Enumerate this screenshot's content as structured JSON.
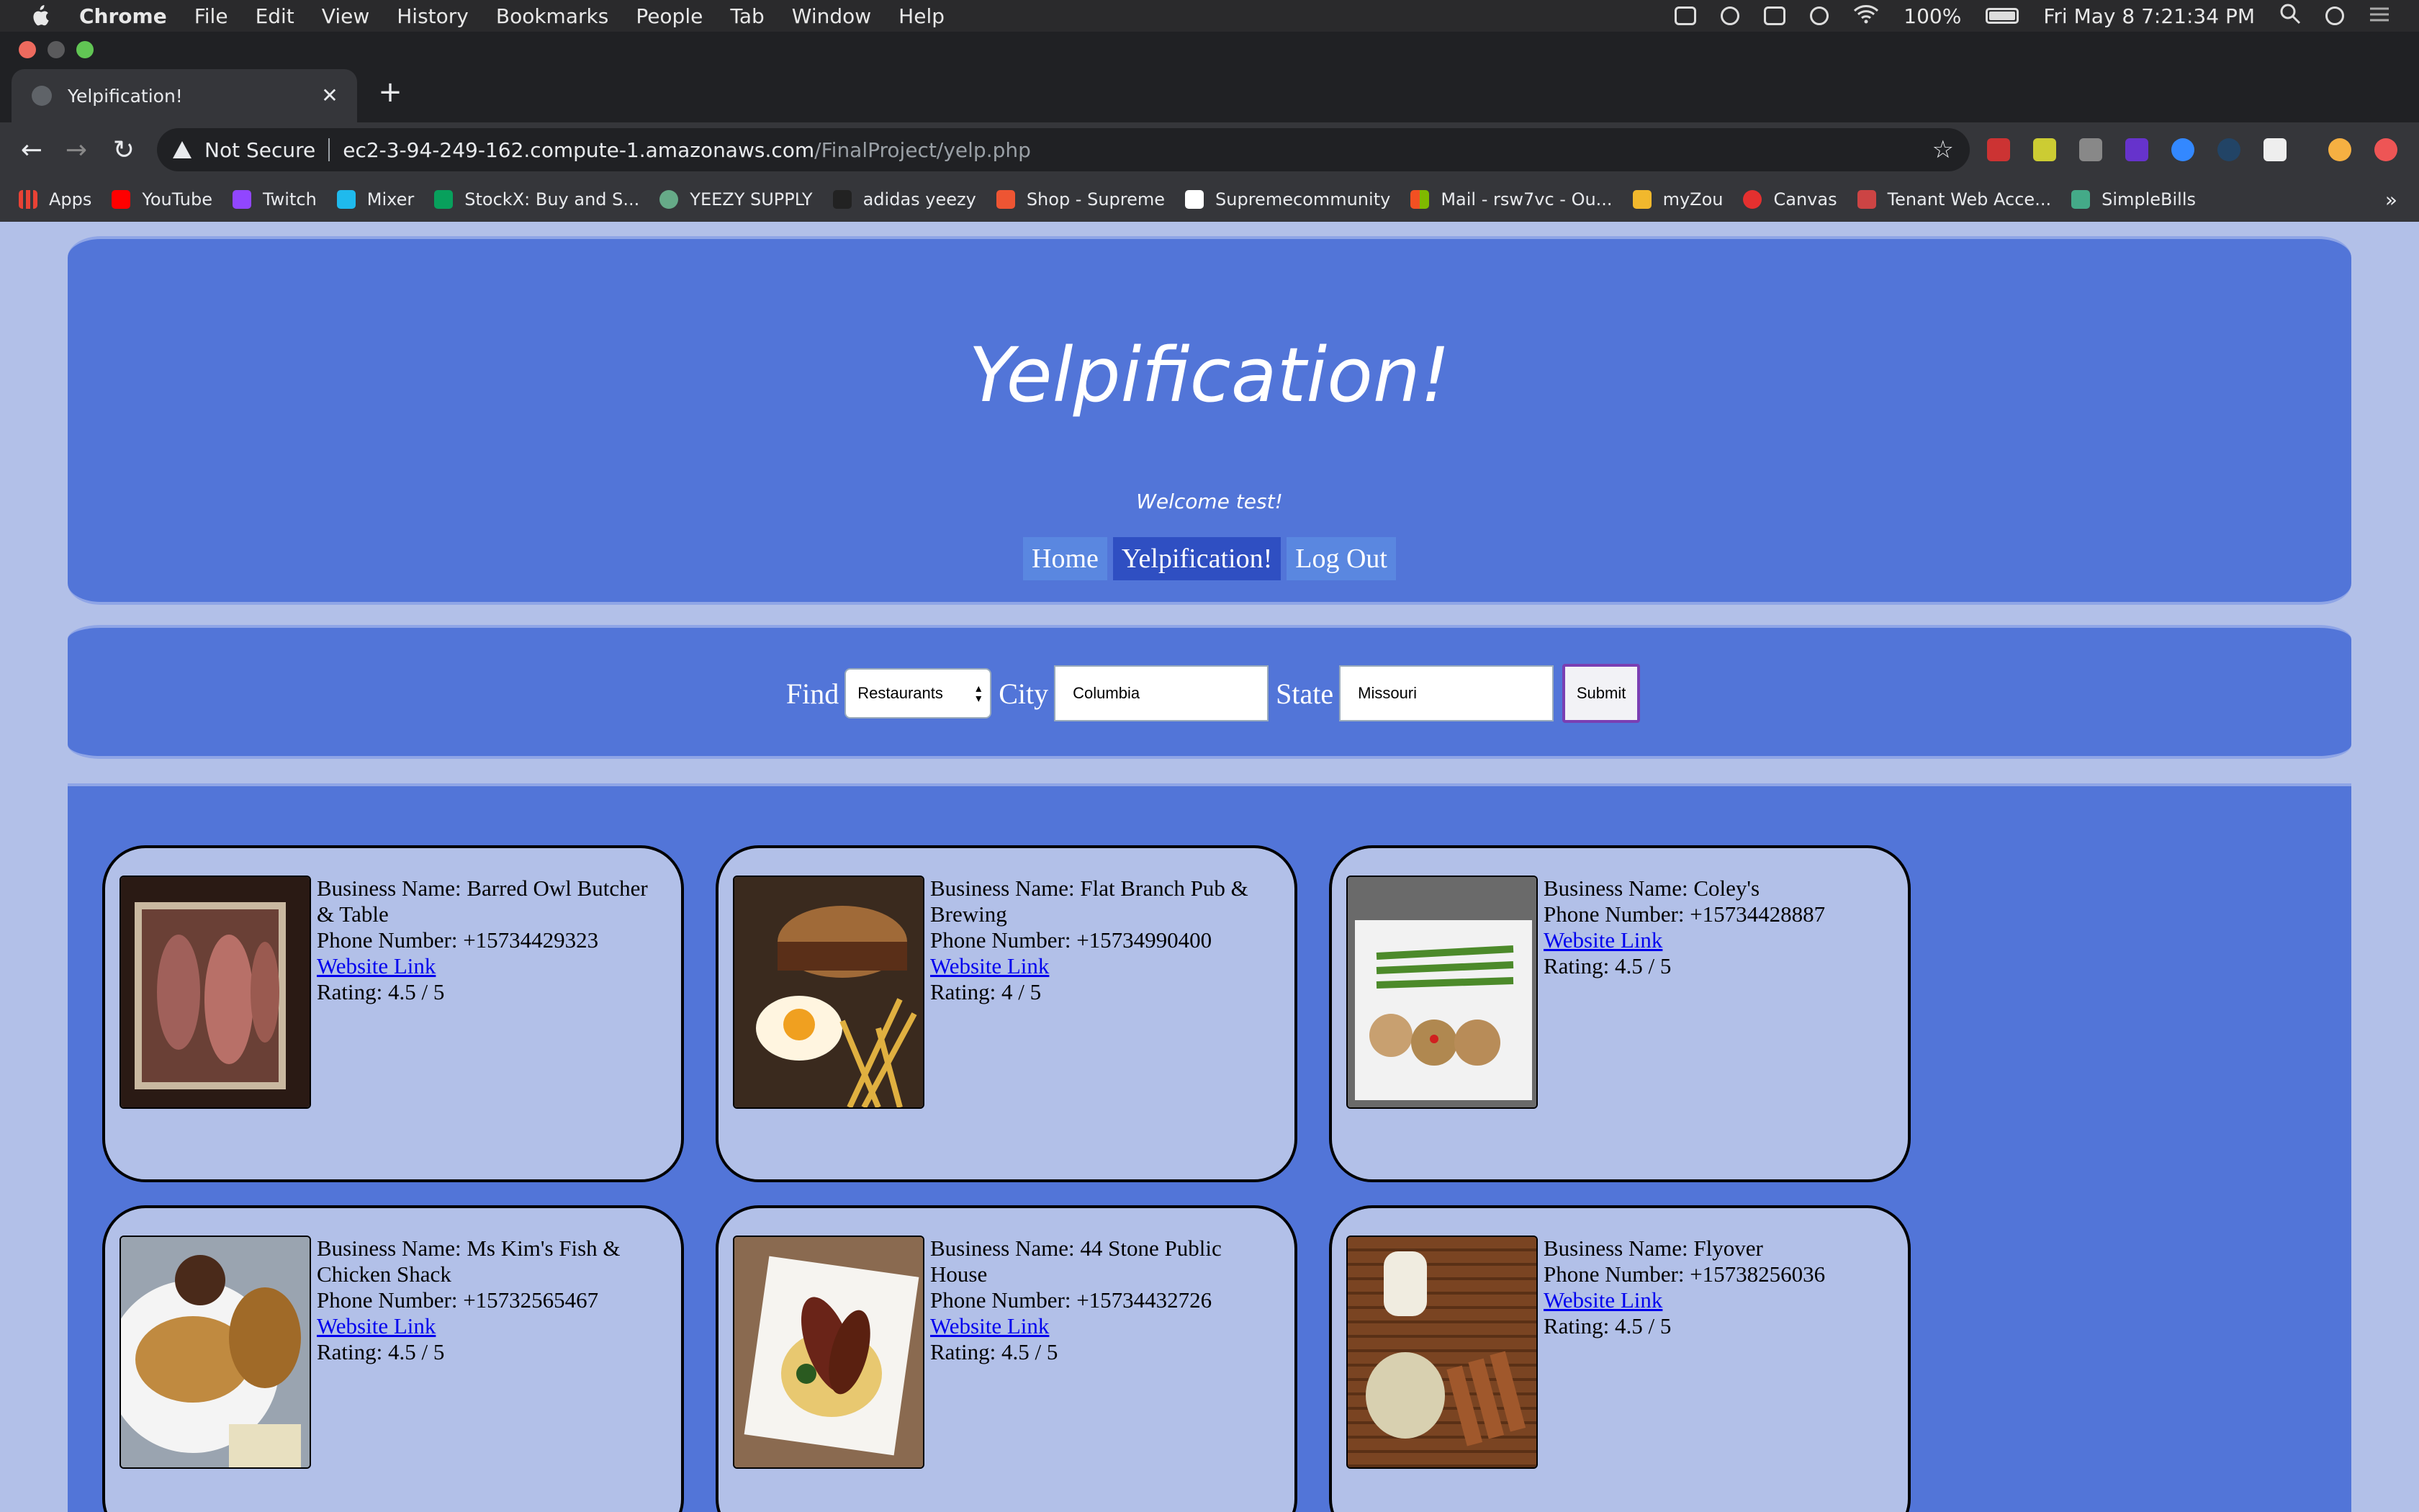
{
  "menubar": {
    "app": "Chrome",
    "items": [
      "File",
      "Edit",
      "View",
      "History",
      "Bookmarks",
      "People",
      "Tab",
      "Window",
      "Help"
    ],
    "battery": "100%",
    "clock": "Fri May 8  7:21:34 PM"
  },
  "browser": {
    "tab_title": "Yelpification!",
    "security_label": "Not Secure",
    "url_host": "ec2-3-94-249-162.compute-1.amazonaws.com",
    "url_path": "/FinalProject/yelp.php",
    "bookmarks": [
      {
        "label": "Apps",
        "color": "#e94235"
      },
      {
        "label": "YouTube",
        "color": "#ff0000"
      },
      {
        "label": "Twitch",
        "color": "#9146ff"
      },
      {
        "label": "Mixer",
        "color": "#1fbaed"
      },
      {
        "label": "StockX: Buy and S...",
        "color": "#08a05c"
      },
      {
        "label": "YEEZY SUPPLY",
        "color": "#6a8"
      },
      {
        "label": "adidas yeezy",
        "color": "#222"
      },
      {
        "label": "Shop - Supreme",
        "color": "#e53"
      },
      {
        "label": "Supremecommunity",
        "color": "#fff"
      },
      {
        "label": "Mail - rsw7vc - Ou...",
        "color": "#f25022"
      },
      {
        "label": "myZou",
        "color": "#f1b82d"
      },
      {
        "label": "Canvas",
        "color": "#e4302f"
      },
      {
        "label": "Tenant Web Acce...",
        "color": "#c44"
      },
      {
        "label": "SimpleBills",
        "color": "#4a8"
      }
    ]
  },
  "page": {
    "title": "Yelpification!",
    "welcome": "Welcome test!",
    "nav": [
      "Home",
      "Yelpification!",
      "Log Out"
    ],
    "search": {
      "find_label": "Find",
      "find_value": "Restaurants",
      "city_label": "City",
      "city_value": "Columbia",
      "state_label": "State",
      "state_value": "Missouri",
      "submit": "Submit"
    },
    "businesses": [
      {
        "name_line": "Business Name: Barred Owl Butcher & Table",
        "phone_line": "Phone Number: +15734429323",
        "link": "Website Link",
        "rating_line": "Rating: 4.5 / 5"
      },
      {
        "name_line": "Business Name: Flat Branch Pub & Brewing",
        "phone_line": "Phone Number: +15734990400",
        "link": "Website Link",
        "rating_line": "Rating: 4 / 5"
      },
      {
        "name_line": "Business Name: Coley's",
        "phone_line": "Phone Number: +15734428887",
        "link": "Website Link",
        "rating_line": "Rating: 4.5 / 5"
      },
      {
        "name_line": "Business Name: Ms Kim's Fish & Chicken Shack",
        "phone_line": "Phone Number: +15732565467",
        "link": "Website Link",
        "rating_line": "Rating: 4.5 / 5"
      },
      {
        "name_line": "Business Name: 44 Stone Public House",
        "phone_line": "Phone Number: +15734432726",
        "link": "Website Link",
        "rating_line": "Rating: 4.5 / 5"
      },
      {
        "name_line": "Business Name: Flyover",
        "phone_line": "Phone Number: +15738256036",
        "link": "Website Link",
        "rating_line": "Rating: 4.5 / 5"
      }
    ]
  }
}
